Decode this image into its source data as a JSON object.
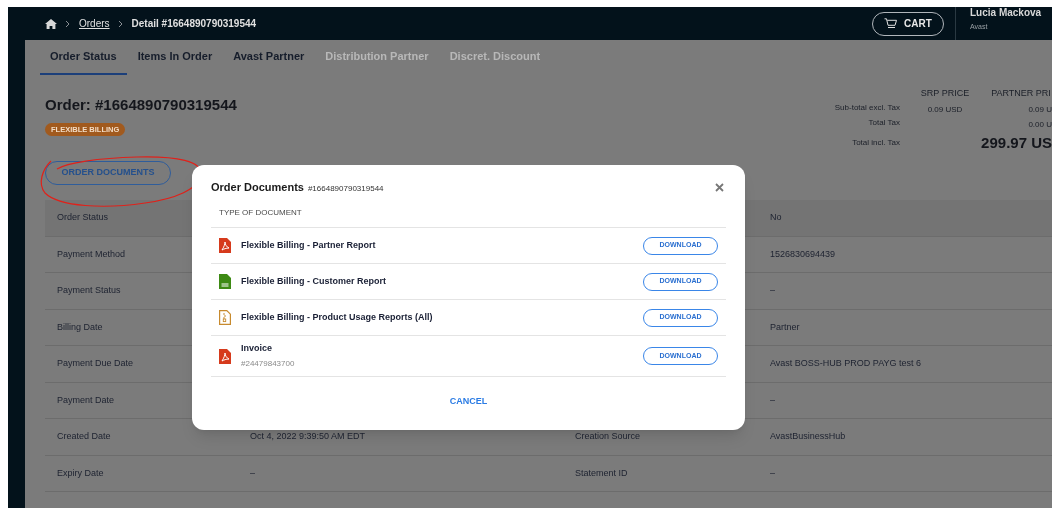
{
  "breadcrumb": [
    {
      "label": "Orders",
      "link": true
    },
    {
      "label": "Detail #1664890790319544",
      "link": false
    }
  ],
  "cart_button": "CART",
  "user": {
    "name": "Lucia Mackova",
    "company": "Avast"
  },
  "tabs": [
    {
      "label": "Order Status",
      "selected": true,
      "disabled": false
    },
    {
      "label": "Items In Order",
      "selected": false,
      "disabled": false
    },
    {
      "label": "Avast Partner",
      "selected": false,
      "disabled": false
    },
    {
      "label": "Distribution Partner",
      "selected": false,
      "disabled": true
    },
    {
      "label": "Discret. Discount",
      "selected": false,
      "disabled": true
    }
  ],
  "order": {
    "title": "Order: #1664890790319544",
    "badge": "FLEXIBLE BILLING",
    "documents_button": "ORDER DOCUMENTS"
  },
  "pricing": {
    "columns": [
      "SRP PRICE",
      "PARTNER PRI"
    ],
    "rows": [
      {
        "kind": "line",
        "label": "Sub-total excl. Tax",
        "srp": "0.09 USD",
        "partner": "0.09 U"
      },
      {
        "kind": "line",
        "label": "Total Tax",
        "partner": "0.00 U"
      },
      {
        "kind": "total",
        "label": "Total incl. Tax",
        "partner": "299.97 US"
      }
    ]
  },
  "details": [
    {
      "label": "Order Status",
      "right_value": "No"
    },
    {
      "label": "Payment Method",
      "right_value": "1526830694439"
    },
    {
      "label": "Payment Status",
      "right_value": "–"
    },
    {
      "label": "Billing Date",
      "right_value": "Partner"
    },
    {
      "label": "Payment Due Date",
      "right_value": "Avast BOSS-HUB PROD PAYG test 6"
    },
    {
      "label": "Payment Date",
      "right_value": "–"
    },
    {
      "label": "Created Date",
      "value": "Oct 4, 2022 9:39:50 AM EDT",
      "right_label": "Creation Source",
      "right_value": "AvastBusinessHub"
    },
    {
      "label": "Expiry Date",
      "value": "–",
      "right_label": "Statement ID",
      "right_value": "–"
    }
  ],
  "modal": {
    "title": "Order Documents",
    "order_number": "#1664890790319544",
    "column": "TYPE OF DOCUMENT",
    "documents": [
      {
        "kind": "pdf",
        "name": "Flexible Billing - Partner Report",
        "button": "DOWNLOAD"
      },
      {
        "kind": "csv",
        "name": "Flexible Billing - Customer Report",
        "button": "DOWNLOAD"
      },
      {
        "kind": "zip",
        "name": "Flexible Billing - Product Usage Reports (All)",
        "button": "DOWNLOAD"
      },
      {
        "kind": "pdf",
        "name": "Invoice",
        "number": "#24479843700",
        "button": "DOWNLOAD"
      }
    ],
    "cancel": "CANCEL"
  }
}
